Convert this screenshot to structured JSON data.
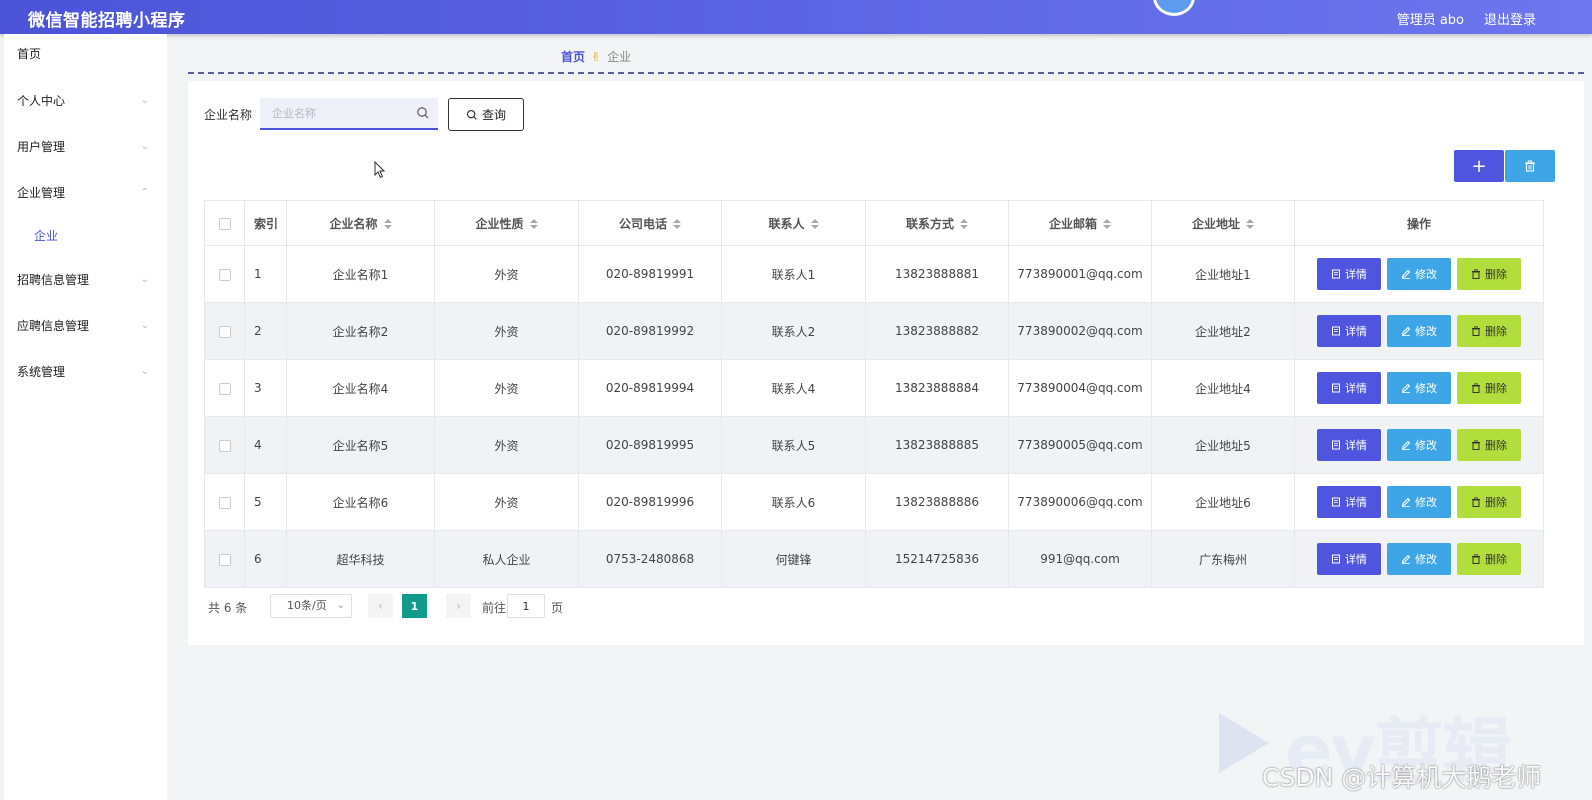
{
  "app": {
    "title": "微信智能招聘小程序"
  },
  "header": {
    "admin_label": "管理员 abo",
    "logout_label": "退出登录"
  },
  "sidebar": {
    "items": [
      {
        "label": "首页",
        "has_arrow": false
      },
      {
        "label": "个人中心",
        "has_arrow": true
      },
      {
        "label": "用户管理",
        "has_arrow": true
      },
      {
        "label": "企业管理",
        "has_arrow": true,
        "expanded": true
      },
      {
        "label": "招聘信息管理",
        "has_arrow": true
      },
      {
        "label": "应聘信息管理",
        "has_arrow": true
      },
      {
        "label": "系统管理",
        "has_arrow": true
      }
    ],
    "submenu": {
      "label": "企业"
    }
  },
  "breadcrumb": {
    "home": "首页",
    "separator_icon": "hand-icon",
    "current": "企业"
  },
  "search": {
    "label": "企业名称",
    "placeholder": "企业名称",
    "value": "",
    "button_label": "查询"
  },
  "toolbar": {
    "add_label": "+",
    "delete_icon": "trash-icon"
  },
  "table": {
    "columns": [
      "索引",
      "企业名称",
      "企业性质",
      "公司电话",
      "联系人",
      "联系方式",
      "企业邮箱",
      "企业地址",
      "操作"
    ],
    "rows": [
      {
        "index": "1",
        "name": "企业名称1",
        "nature": "外资",
        "phone": "020-89819991",
        "contact": "联系人1",
        "mobile": "13823888881",
        "email": "773890001@qq.com",
        "address": "企业地址1"
      },
      {
        "index": "2",
        "name": "企业名称2",
        "nature": "外资",
        "phone": "020-89819992",
        "contact": "联系人2",
        "mobile": "13823888882",
        "email": "773890002@qq.com",
        "address": "企业地址2"
      },
      {
        "index": "3",
        "name": "企业名称4",
        "nature": "外资",
        "phone": "020-89819994",
        "contact": "联系人4",
        "mobile": "13823888884",
        "email": "773890004@qq.com",
        "address": "企业地址4"
      },
      {
        "index": "4",
        "name": "企业名称5",
        "nature": "外资",
        "phone": "020-89819995",
        "contact": "联系人5",
        "mobile": "13823888885",
        "email": "773890005@qq.com",
        "address": "企业地址5"
      },
      {
        "index": "5",
        "name": "企业名称6",
        "nature": "外资",
        "phone": "020-89819996",
        "contact": "联系人6",
        "mobile": "13823888886",
        "email": "773890006@qq.com",
        "address": "企业地址6"
      },
      {
        "index": "6",
        "name": "超华科技",
        "nature": "私人企业",
        "phone": "0753-2480868",
        "contact": "何键锋",
        "mobile": "15214725836",
        "email": "991@qq.com",
        "address": "广东梅州"
      }
    ],
    "actions": {
      "detail": "详情",
      "edit": "修改",
      "delete": "删除"
    }
  },
  "pagination": {
    "total": "共 6 条",
    "page_size": "10条/页",
    "current_page": "1",
    "goto_label": "前往",
    "goto_value": "1",
    "page_unit": "页"
  },
  "watermark": {
    "brand": "ev剪辑",
    "credit": "CSDN @计算机大鹅老师"
  },
  "colors": {
    "header": "#5b62e6",
    "primary": "#4f55df",
    "info": "#3ea6e6",
    "lime": "#b1de3c",
    "page_active": "#119b8a"
  }
}
